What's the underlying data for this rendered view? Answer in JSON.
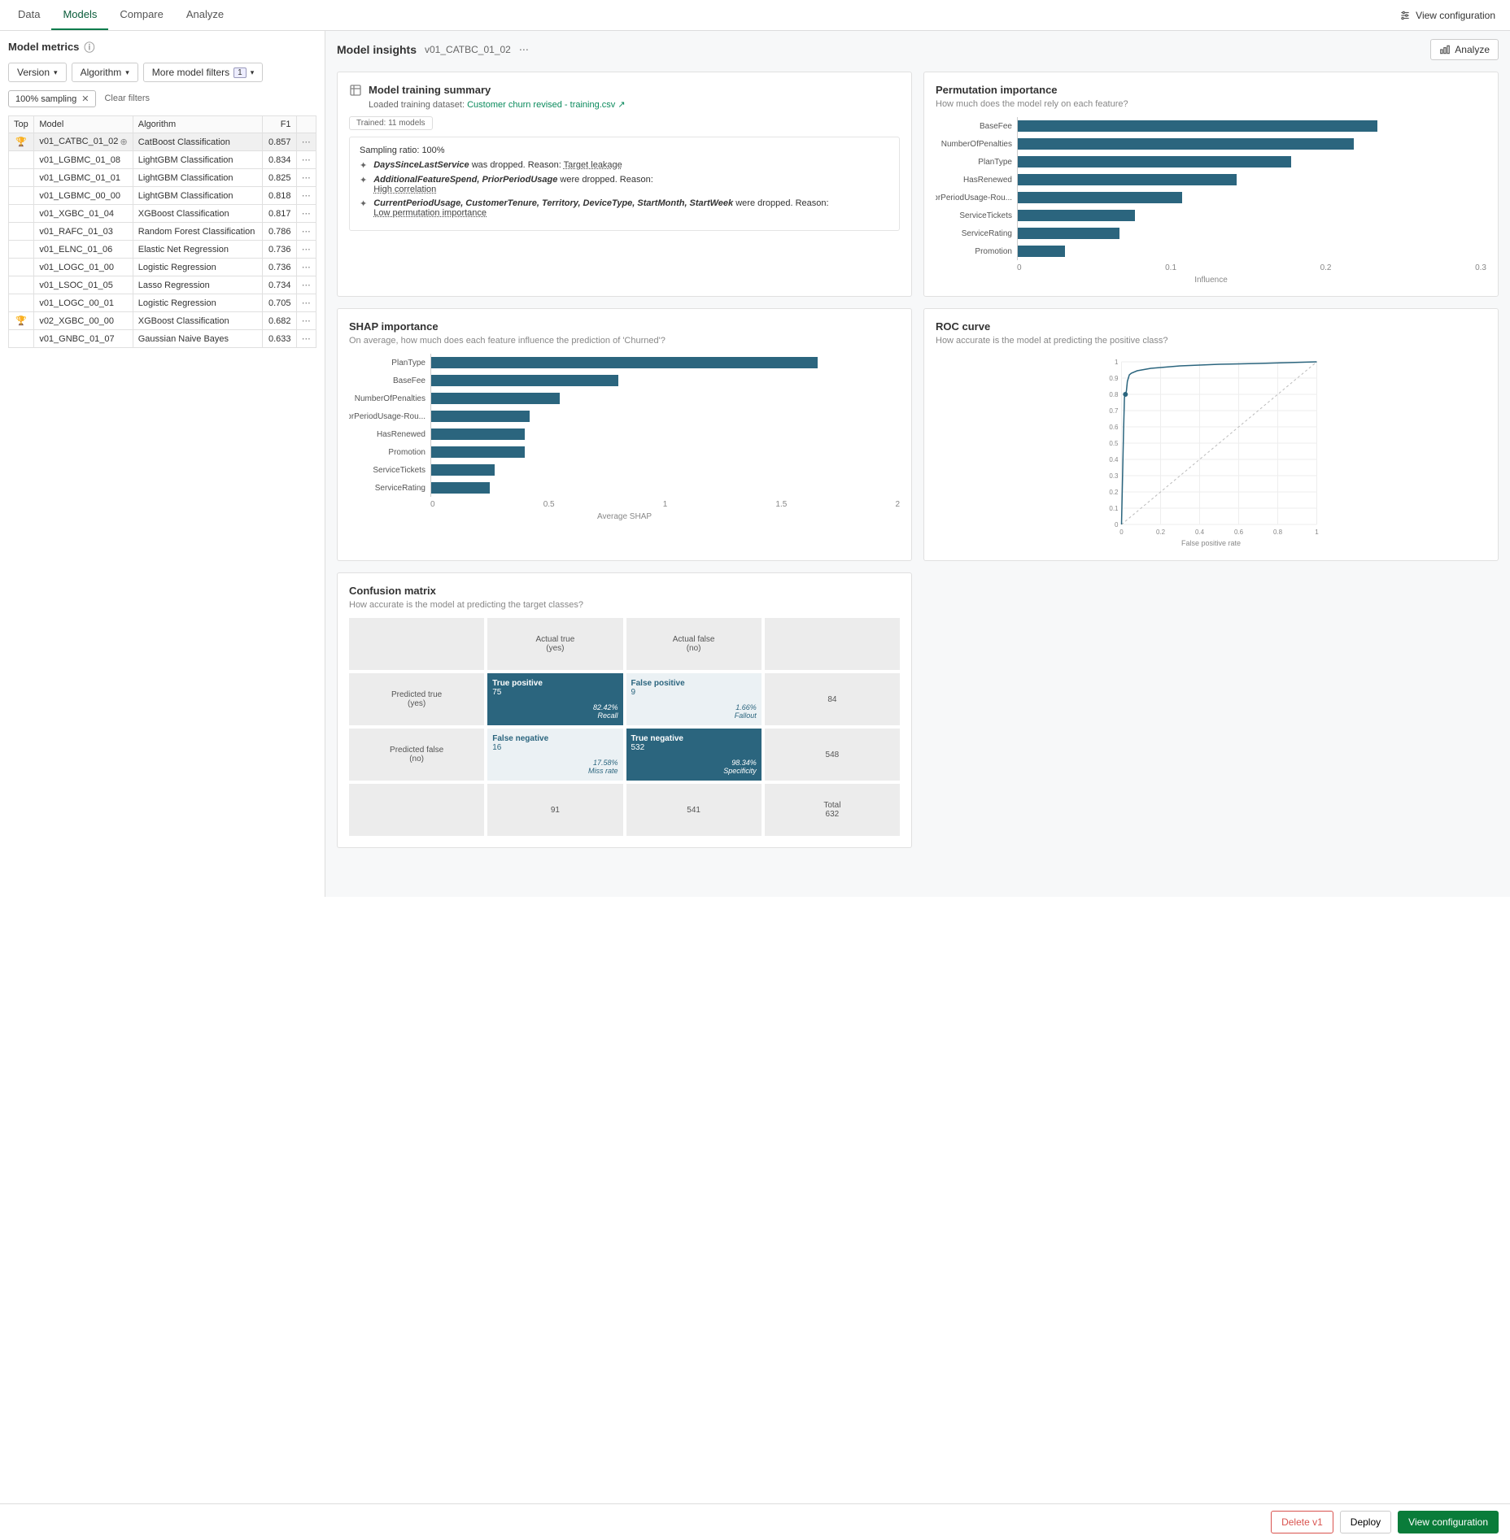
{
  "tabs": [
    "Data",
    "Models",
    "Compare",
    "Analyze"
  ],
  "activeTab": "Models",
  "viewConfiguration": "View configuration",
  "leftPanel": {
    "title": "Model metrics",
    "filters": {
      "version": "Version",
      "algorithm": "Algorithm",
      "more": "More model filters",
      "moreCount": "1"
    },
    "chip": "100% sampling",
    "clear": "Clear filters",
    "columns": [
      "Top",
      "Model",
      "Algorithm",
      "F1",
      ""
    ],
    "rows": [
      {
        "top": true,
        "model": "v01_CATBC_01_02",
        "algo": "CatBoost Classification",
        "f1": "0.857",
        "selected": true,
        "viewed": true
      },
      {
        "top": false,
        "model": "v01_LGBMC_01_08",
        "algo": "LightGBM Classification",
        "f1": "0.834"
      },
      {
        "top": false,
        "model": "v01_LGBMC_01_01",
        "algo": "LightGBM Classification",
        "f1": "0.825"
      },
      {
        "top": false,
        "model": "v01_LGBMC_00_00",
        "algo": "LightGBM Classification",
        "f1": "0.818"
      },
      {
        "top": false,
        "model": "v01_XGBC_01_04",
        "algo": "XGBoost Classification",
        "f1": "0.817"
      },
      {
        "top": false,
        "model": "v01_RAFC_01_03",
        "algo": "Random Forest Classification",
        "f1": "0.786"
      },
      {
        "top": false,
        "model": "v01_ELNC_01_06",
        "algo": "Elastic Net Regression",
        "f1": "0.736"
      },
      {
        "top": false,
        "model": "v01_LOGC_01_00",
        "algo": "Logistic Regression",
        "f1": "0.736"
      },
      {
        "top": false,
        "model": "v01_LSOC_01_05",
        "algo": "Lasso Regression",
        "f1": "0.734"
      },
      {
        "top": false,
        "model": "v01_LOGC_00_01",
        "algo": "Logistic Regression",
        "f1": "0.705"
      },
      {
        "top": true,
        "model": "v02_XGBC_00_00",
        "algo": "XGBoost Classification",
        "f1": "0.682"
      },
      {
        "top": false,
        "model": "v01_GNBC_01_07",
        "algo": "Gaussian Naive Bayes",
        "f1": "0.633"
      }
    ]
  },
  "insights": {
    "title": "Model insights",
    "model": "v01_CATBC_01_02",
    "analyze": "Analyze"
  },
  "training": {
    "title": "Model training summary",
    "loadedLabel": "Loaded training dataset:",
    "dataset": "Customer churn revised - training.csv",
    "pill": "Trained: 11 models",
    "samplingLabel": "Sampling ratio:",
    "samplingValue": "100%",
    "drops": [
      {
        "features": "DaysSinceLastService",
        "suffix": " was dropped. Reason: ",
        "reason": "Target leakage"
      },
      {
        "features": "AdditionalFeatureSpend, PriorPeriodUsage",
        "suffix": " were dropped. Reason:",
        "reason": "High correlation"
      },
      {
        "features": "CurrentPeriodUsage, CustomerTenure, Territory, DeviceType, StartMonth, StartWeek",
        "suffix": " were dropped. Reason:",
        "reason": "Low permutation importance"
      }
    ]
  },
  "permutation": {
    "title": "Permutation importance",
    "sub": "How much does the model rely on each feature?",
    "xlabel": "Influence"
  },
  "shap": {
    "title": "SHAP importance",
    "sub": "On average, how much does each feature influence the prediction of 'Churned'?",
    "xlabel": "Average SHAP"
  },
  "roc": {
    "title": "ROC curve",
    "sub": "How accurate is the model at predicting the positive class?",
    "xlabel": "False positive rate"
  },
  "confusion": {
    "title": "Confusion matrix",
    "sub": "How accurate is the model at predicting the target classes?",
    "headers": {
      "actualTrue": "Actual true\n(yes)",
      "actualFalse": "Actual false\n(no)",
      "predTrue": "Predicted true\n(yes)",
      "predFalse": "Predicted false\n(no)"
    },
    "cells": {
      "tp": {
        "label": "True positive",
        "val": "75",
        "pct": "82.42%",
        "metric": "Recall"
      },
      "fp": {
        "label": "False positive",
        "val": "9",
        "pct": "1.66%",
        "metric": "Fallout"
      },
      "fn": {
        "label": "False negative",
        "val": "16",
        "pct": "17.58%",
        "metric": "Miss rate"
      },
      "tn": {
        "label": "True negative",
        "val": "532",
        "pct": "98.34%",
        "metric": "Specificity"
      },
      "rowT": "84",
      "rowF": "548",
      "colT": "91",
      "colF": "541",
      "totalLabel": "Total",
      "total": "632"
    }
  },
  "footer": {
    "delete": "Delete v1",
    "deploy": "Deploy",
    "view": "View configuration"
  },
  "chart_data": [
    {
      "id": "permutation",
      "type": "bar",
      "orientation": "horizontal",
      "categories": [
        "BaseFee",
        "NumberOfPenalties",
        "PlanType",
        "HasRenewed",
        "PriorPeriodUsage-Rou...",
        "ServiceTickets",
        "ServiceRating",
        "Promotion"
      ],
      "values": [
        0.23,
        0.215,
        0.175,
        0.14,
        0.105,
        0.075,
        0.065,
        0.03
      ],
      "xlim": [
        0,
        0.3
      ],
      "xticks": [
        0,
        0.1,
        0.2,
        0.3
      ],
      "xlabel": "Influence"
    },
    {
      "id": "shap",
      "type": "bar",
      "orientation": "horizontal",
      "categories": [
        "PlanType",
        "BaseFee",
        "NumberOfPenalties",
        "PriorPeriodUsage-Rou...",
        "HasRenewed",
        "Promotion",
        "ServiceTickets",
        "ServiceRating"
      ],
      "values": [
        1.65,
        0.8,
        0.55,
        0.42,
        0.4,
        0.4,
        0.27,
        0.25
      ],
      "xlim": [
        0,
        2
      ],
      "xticks": [
        0,
        0.5,
        1,
        1.5,
        2
      ],
      "xlabel": "Average SHAP"
    },
    {
      "id": "roc",
      "type": "line",
      "x": [
        0,
        0.01,
        0.015,
        0.02,
        0.025,
        0.03,
        0.035,
        0.04,
        0.05,
        0.08,
        0.15,
        0.3,
        0.5,
        0.7,
        1.0
      ],
      "y": [
        0,
        0.55,
        0.78,
        0.8,
        0.82,
        0.88,
        0.9,
        0.92,
        0.93,
        0.945,
        0.96,
        0.975,
        0.985,
        0.99,
        1.0
      ],
      "reference": {
        "x": [
          0,
          1
        ],
        "y": [
          0,
          1
        ]
      },
      "xlim": [
        0,
        1
      ],
      "ylim": [
        0,
        1
      ],
      "xticks": [
        0,
        0.2,
        0.4,
        0.6,
        0.8,
        1
      ],
      "yticks": [
        0,
        0.1,
        0.2,
        0.3,
        0.4,
        0.5,
        0.6,
        0.7,
        0.8,
        0.9,
        1
      ],
      "xlabel": "False positive rate"
    }
  ]
}
